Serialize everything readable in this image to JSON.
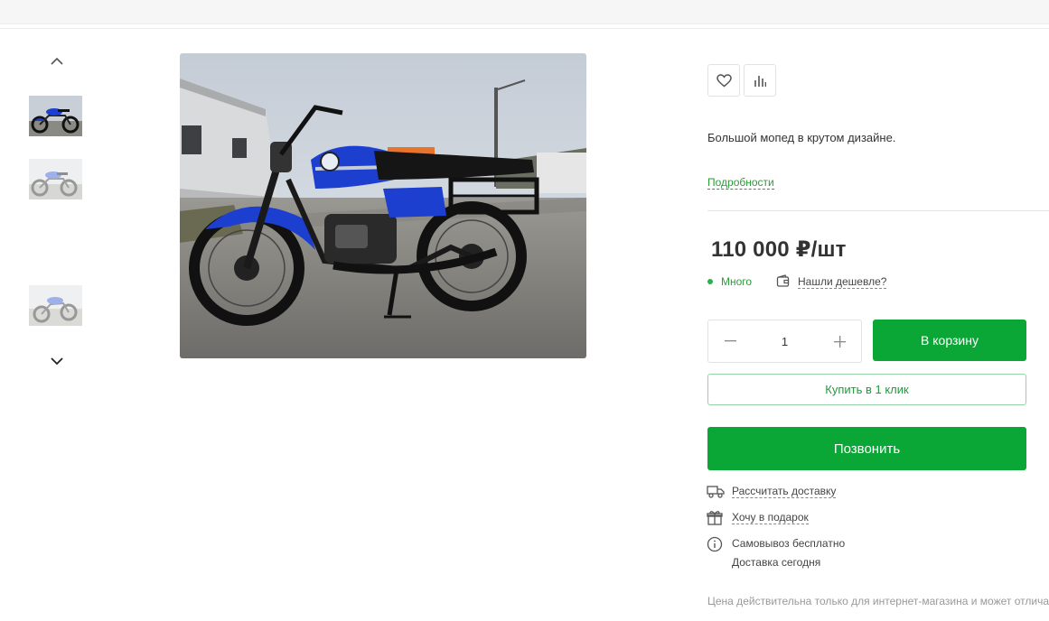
{
  "gallery": {
    "thumbnails": [
      "thumb-1",
      "thumb-2",
      "thumb-3"
    ],
    "main_alt": "moped-photo"
  },
  "product": {
    "description": "Большой мопед в крутом дизайне.",
    "details_link": "Подробности",
    "price": "110 000 ₽/шт",
    "stock": "Много",
    "cheaper_link": "Нашли дешевле?",
    "quantity": "1"
  },
  "actions": {
    "cart": "В корзину",
    "one_click": "Купить в 1 клик",
    "call": "Позвонить"
  },
  "features": {
    "delivery_calc": "Рассчитать доставку",
    "gift": "Хочу в подарок",
    "pickup": "Самовывоз бесплатно",
    "delivery_today": "Доставка сегодня"
  },
  "disclaimer": "Цена действительна только для интернет-магазина и может отлича",
  "colors": {
    "accent_green": "#0aa737",
    "link_green": "#2d9b3a",
    "moped_blue": "#1c3fd0"
  },
  "icons": [
    "chevron-up-icon",
    "chevron-down-icon",
    "heart-icon",
    "compare-icon",
    "wallet-icon",
    "truck-icon",
    "gift-icon",
    "info-icon"
  ]
}
